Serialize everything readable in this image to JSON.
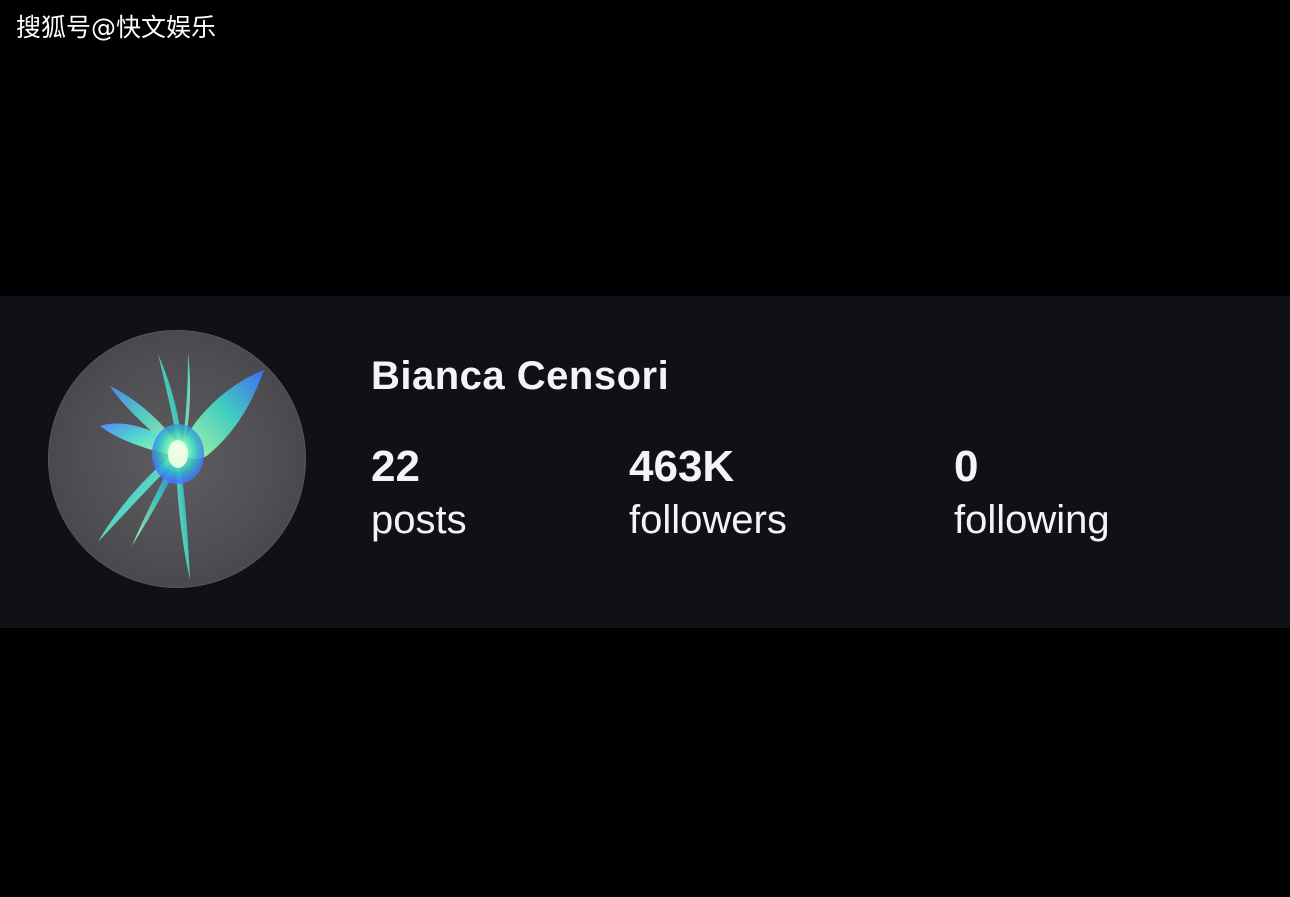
{
  "watermark": {
    "text": "搜狐号@快文娱乐"
  },
  "profile": {
    "name": "Bianca Censori",
    "avatar_icon": "butterfly-icon",
    "stats": [
      {
        "value": "22",
        "label": "posts"
      },
      {
        "value": "463K",
        "label": "followers"
      },
      {
        "value": "0",
        "label": "following"
      }
    ]
  },
  "colors": {
    "page_background": "#000000",
    "band_background": "#0f1117",
    "text": "#f4f4f6",
    "butterfly_green": "#7dffb8",
    "butterfly_blue": "#3f7bff"
  }
}
